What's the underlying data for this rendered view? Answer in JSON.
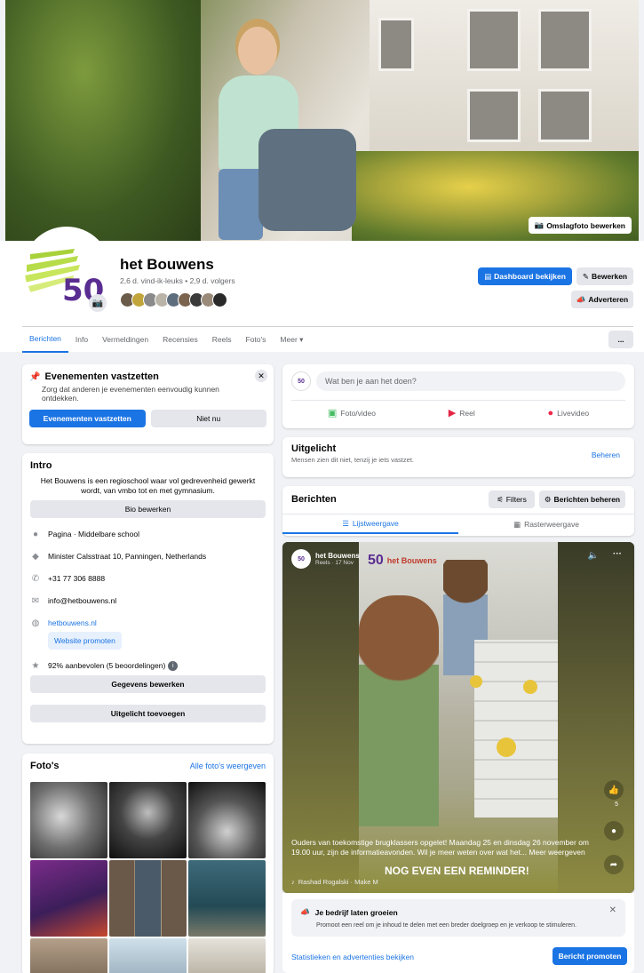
{
  "cover": {
    "edit_label": "Omslagfoto bewerken"
  },
  "profile": {
    "name": "het Bouwens",
    "stats": "2,6 d. vind-ik-leuks • 2,9 d. volgers",
    "dashboard_label": "Dashboard bekijken",
    "edit_label": "Bewerken",
    "advertise_label": "Adverteren",
    "logo_text": "50",
    "more_label": "..."
  },
  "tabs": [
    "Berichten",
    "Info",
    "Vermeldingen",
    "Recensies",
    "Reels",
    "Foto's",
    "Meer ▾"
  ],
  "events": {
    "title": "Evenementen vastzetten",
    "text": "Zorg dat anderen je evenementen eenvoudig kunnen ontdekken.",
    "primary": "Evenementen vastzetten",
    "secondary": "Niet nu"
  },
  "intro": {
    "title": "Intro",
    "bio": "Het Bouwens is een regioschool waar vol gedrevenheid gewerkt wordt, van vmbo tot en met gymnasium.",
    "bio_button": "Bio bewerken",
    "items": [
      "Pagina · Middelbare school",
      "Minister Calsstraat 10, Panningen, Netherlands",
      "+31 77 306 8888",
      "info@hetbouwens.nl",
      "hetbouwens.nl"
    ],
    "promote_site": "Website promoten",
    "rating": "92% aanbevolen (5 beoordelingen)",
    "details_button": "Gegevens bewerken",
    "featured_button": "Uitgelicht toevoegen"
  },
  "photos": {
    "title": "Foto's",
    "all_link": "Alle foto's weergeven"
  },
  "composer": {
    "placeholder": "Wat ben je aan het doen?",
    "photo": "Foto/video",
    "reel": "Reel",
    "live": "Livevideo"
  },
  "featured": {
    "title": "Uitgelicht",
    "subtitle": "Mensen zien dit niet, tenzij je iets vastzet.",
    "manage": "Beheren"
  },
  "posts": {
    "title": "Berichten",
    "filters": "Filters",
    "manage": "Berichten beheren",
    "list_view": "Lijstweergave",
    "grid_view": "Rasterweergave"
  },
  "reel": {
    "author": "het Bouwens",
    "meta": "Reels · 17 Nov",
    "overlay_brand": "het Bouwens",
    "caption": "Ouders van toekomstige brugklassers opgelet! Maandag 25 en dinsdag 26 november om 19.00 uur, zijn de informatieavonden. Wil je meer weten over wat het... Meer weergeven",
    "banner": "NOG EVEN EEN REMINDER!",
    "music": "Rashad Rogalski · Make M",
    "likes": "5"
  },
  "grow": {
    "title": "Je bedrijf laten groeien",
    "text": "Promoot een reel om je inhoud te delen met een breder doelgroep en je verkoop te stimuleren.",
    "insights": "Statistieken en advertenties bekijken",
    "promote": "Bericht promoten"
  },
  "colors": {
    "accent": "#1b74e4",
    "logo_green": "#a8d13a",
    "logo_purple": "#5a2d91"
  }
}
